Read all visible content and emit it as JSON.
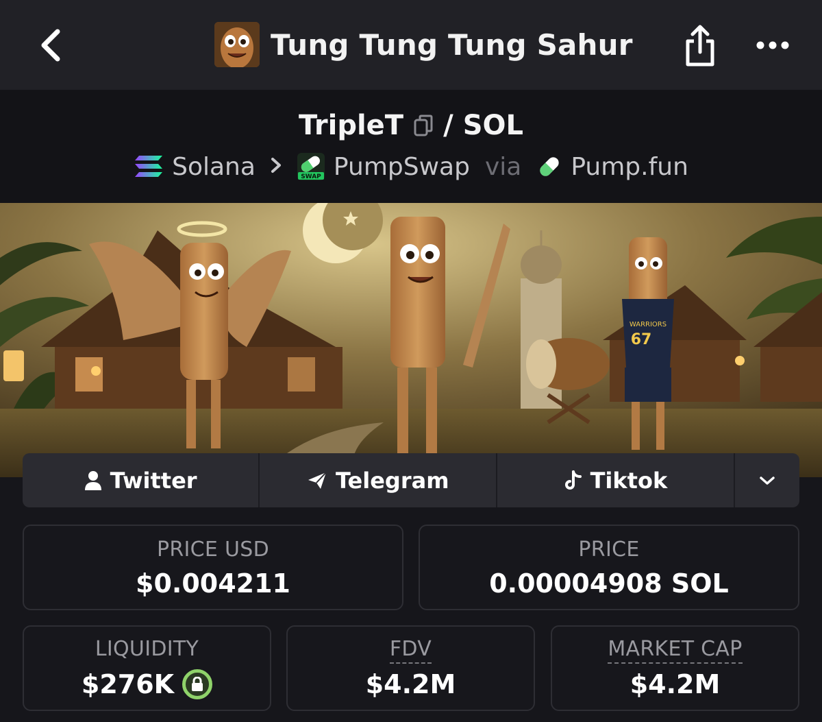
{
  "nav": {
    "title": "Tung Tung Tung Sahur",
    "icons": {
      "back": "chevron-left-icon",
      "share": "share-icon",
      "more": "ellipsis-icon"
    }
  },
  "pair": {
    "base": "TripleT",
    "separator": "/",
    "quote": "SOL",
    "chain": "Solana",
    "dex": "PumpSwap",
    "via_text": "via",
    "launchpad": "Pump.fun",
    "dex_badge": "SWAP"
  },
  "socials": [
    {
      "label": "Twitter",
      "icon": "user-icon"
    },
    {
      "label": "Telegram",
      "icon": "paper-plane-icon"
    },
    {
      "label": "Tiktok",
      "icon": "tiktok-icon"
    }
  ],
  "stats": {
    "price_usd": {
      "label": "PRICE USD",
      "value": "$0.004211"
    },
    "price": {
      "label": "PRICE",
      "value": "0.00004908 SOL"
    },
    "liquidity": {
      "label": "LIQUIDITY",
      "value": "$276K"
    },
    "fdv": {
      "label": "FDV",
      "value": "$4.2M"
    },
    "market_cap": {
      "label": "MARKET CAP",
      "value": "$4.2M"
    }
  },
  "banner": {
    "jersey_text": "WARRIORS",
    "jersey_number": "67"
  },
  "colors": {
    "background": "#16161b",
    "navbar": "#212126",
    "accent_green": "#8fd36a",
    "muted_text": "#9a9aa0"
  }
}
